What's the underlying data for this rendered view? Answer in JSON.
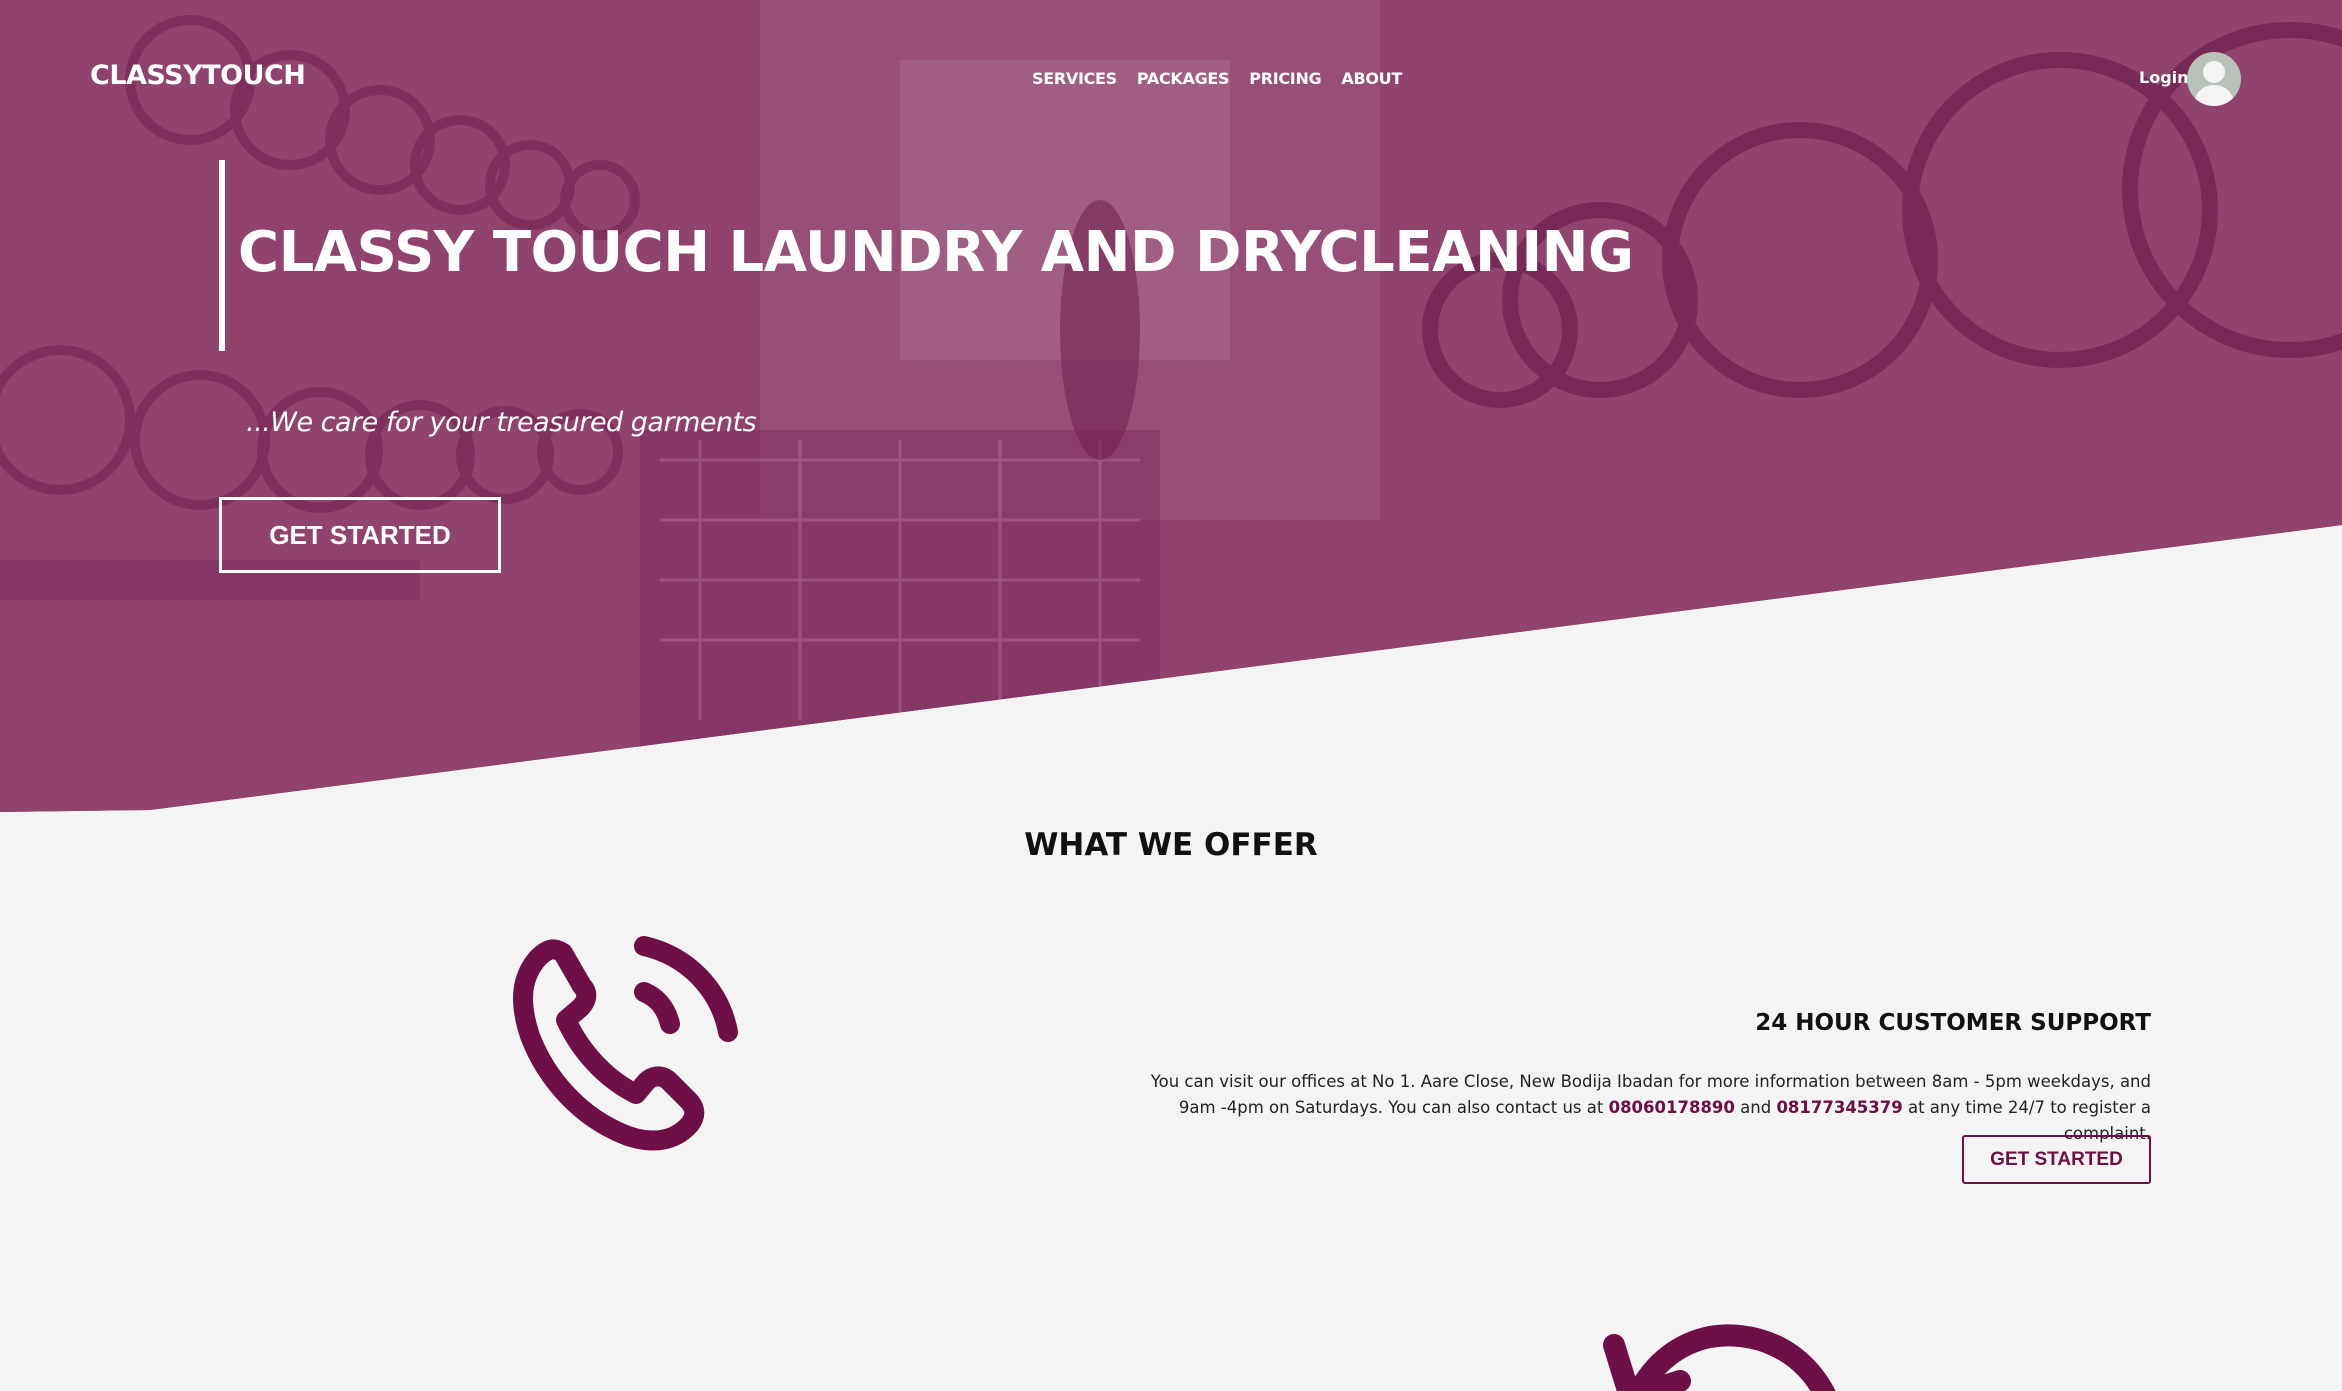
{
  "brand": "CLASSYTOUCH",
  "nav": {
    "items": [
      "SERVICES",
      "PACKAGES",
      "PRICING",
      "ABOUT"
    ],
    "login_label": "Login"
  },
  "hero": {
    "title": "CLASSY TOUCH LAUNDRY AND DRYCLEANING",
    "tagline": "...We care for your treasured garments",
    "cta_label": "GET STARTED",
    "tint_color": "#8a3e68"
  },
  "offers": {
    "section_title": "WHAT WE OFFER",
    "items": [
      {
        "icon": "phone-icon",
        "title": "24 HOUR CUSTOMER SUPPORT",
        "text_before": "You can visit our offices at No 1. Aare Close, New Bodija Ibadan for more information between 8am - 5pm weekdays, and 9am -4pm on Saturdays. You can also contact us at ",
        "phone_1": "08060178890",
        "text_mid": " and ",
        "phone_2": "08177345379",
        "text_after": " at any time 24/7 to register a complaint.",
        "cta_label": "GET STARTED"
      }
    ],
    "next_icon": "refresh-icon",
    "accent_color": "#6e0f46"
  }
}
